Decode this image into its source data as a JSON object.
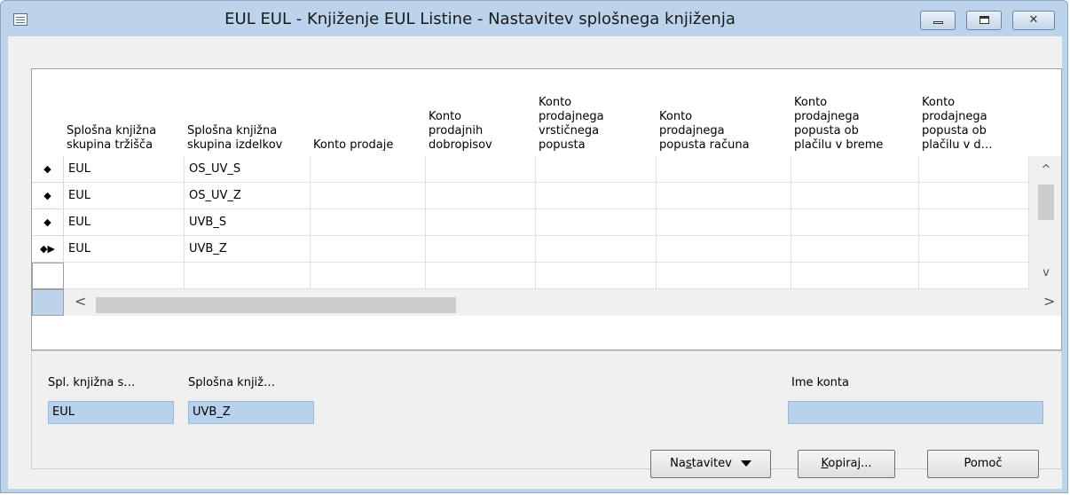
{
  "window": {
    "title": "EUL EUL - Knjiženje EUL Listine - Nastavitev splošnega knjiženja",
    "close_glyph": "✕"
  },
  "grid": {
    "columns": [
      "Splošna knjižna\nskupina tržišča",
      "Splošna knjižna\nskupina izdelkov",
      "Konto prodaje",
      "Konto\nprodajnih\ndobropisov",
      "Konto\nprodajnega\nvrstičnega\npopusta",
      "Konto\nprodajnega\npopusta računa",
      "Konto\nprodajnega\npopusta ob\nplačilu v breme",
      "Konto\nprodajnega\npopusta ob\nplačilu v d…"
    ],
    "rows": [
      {
        "marker": "◆",
        "market": "EUL",
        "product": "OS_UV_S"
      },
      {
        "marker": "◆",
        "market": "EUL",
        "product": "OS_UV_Z"
      },
      {
        "marker": "◆",
        "market": "EUL",
        "product": "UVB_S"
      },
      {
        "marker": "◆▶",
        "market": "EUL",
        "product": "UVB_Z"
      }
    ],
    "scroll_up": "^",
    "scroll_down": "v",
    "scroll_left": "<",
    "scroll_right": ">"
  },
  "detail": {
    "label_market": "Spl. knjižna s…",
    "label_product": "Splošna knjiž…",
    "label_account": "Ime konta",
    "value_market": "EUL",
    "value_product": "UVB_Z",
    "value_account": ""
  },
  "buttons": {
    "setup_pre": "Na",
    "setup_ul": "s",
    "setup_post": "tavitev",
    "copy_ul": "K",
    "copy_post": "opiraj...",
    "help": "Pomoč"
  }
}
